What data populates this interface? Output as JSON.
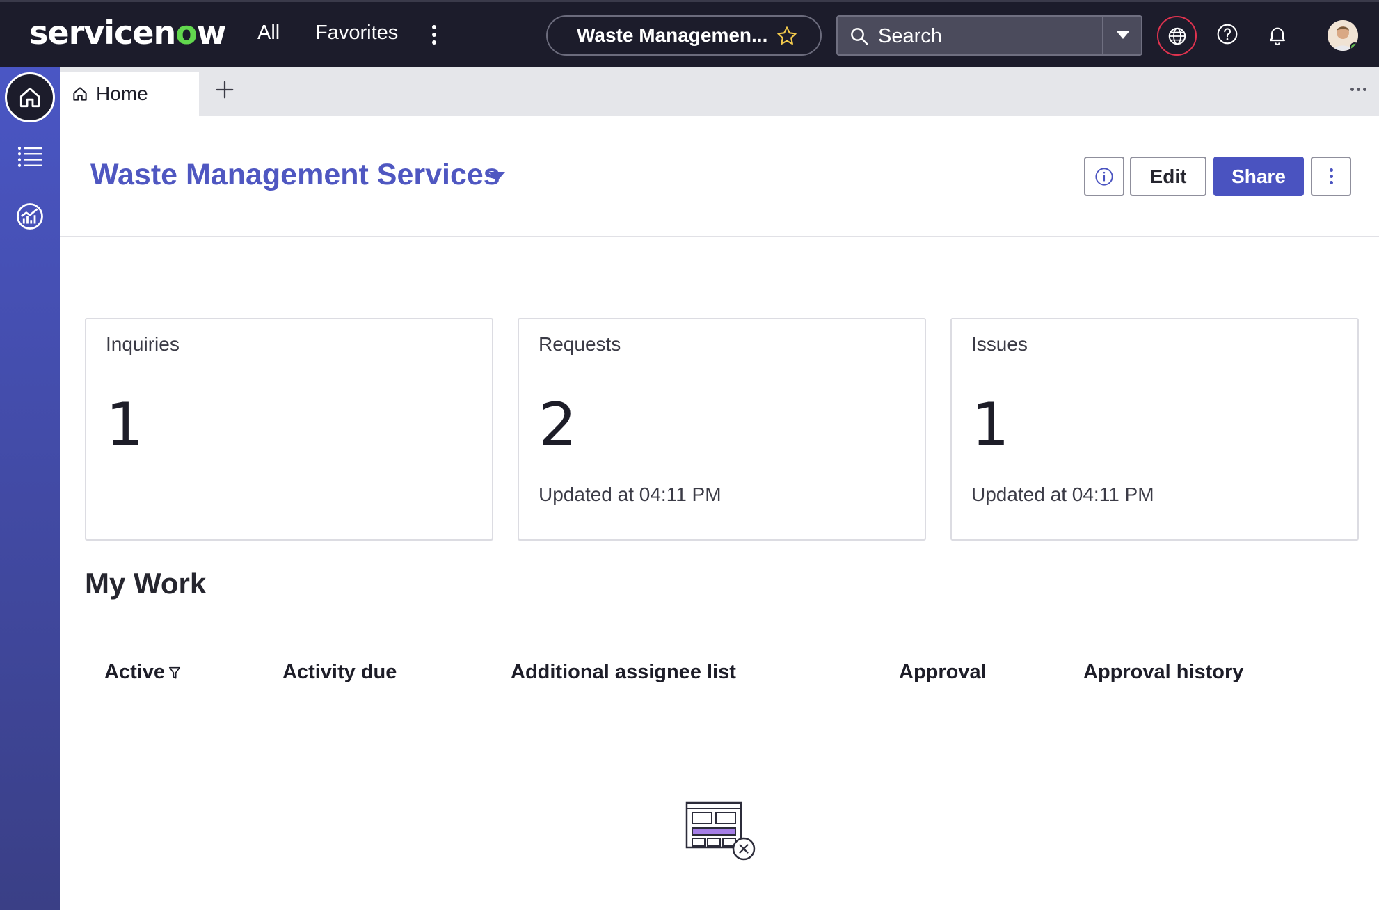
{
  "topbar": {
    "logo_text_pre": "servicen",
    "logo_text_o": "o",
    "logo_text_post": "w",
    "nav_all": "All",
    "nav_favorites": "Favorites",
    "context_title": "Waste Managemen...",
    "search_placeholder": "Search",
    "icons": [
      "more-vertical-icon",
      "star-icon",
      "search-icon",
      "chevron-down-icon",
      "globe-icon",
      "help-icon",
      "bell-icon",
      "avatar"
    ]
  },
  "sidebar": {
    "items": [
      {
        "name": "home",
        "icon": "home-icon"
      },
      {
        "name": "list",
        "icon": "list-icon"
      },
      {
        "name": "analytics",
        "icon": "analytics-icon"
      }
    ]
  },
  "tabs": {
    "home_label": "Home"
  },
  "header": {
    "title": "Waste Management Services",
    "edit_label": "Edit",
    "share_label": "Share"
  },
  "cards": [
    {
      "title": "Inquiries",
      "value": "1",
      "updated": ""
    },
    {
      "title": "Requests",
      "value": "2",
      "updated": "Updated at 04:11 PM"
    },
    {
      "title": "Issues",
      "value": "1",
      "updated": "Updated at 04:11 PM"
    }
  ],
  "my_work": {
    "title": "My Work",
    "columns": [
      "Active",
      "Activity due",
      "Additional assignee list",
      "Approval",
      "Approval history"
    ]
  },
  "colors": {
    "topbar_bg": "#1c1c2b",
    "accent": "#4a53c0",
    "logo_o": "#62d84e",
    "globe_ring": "#e0334f"
  }
}
